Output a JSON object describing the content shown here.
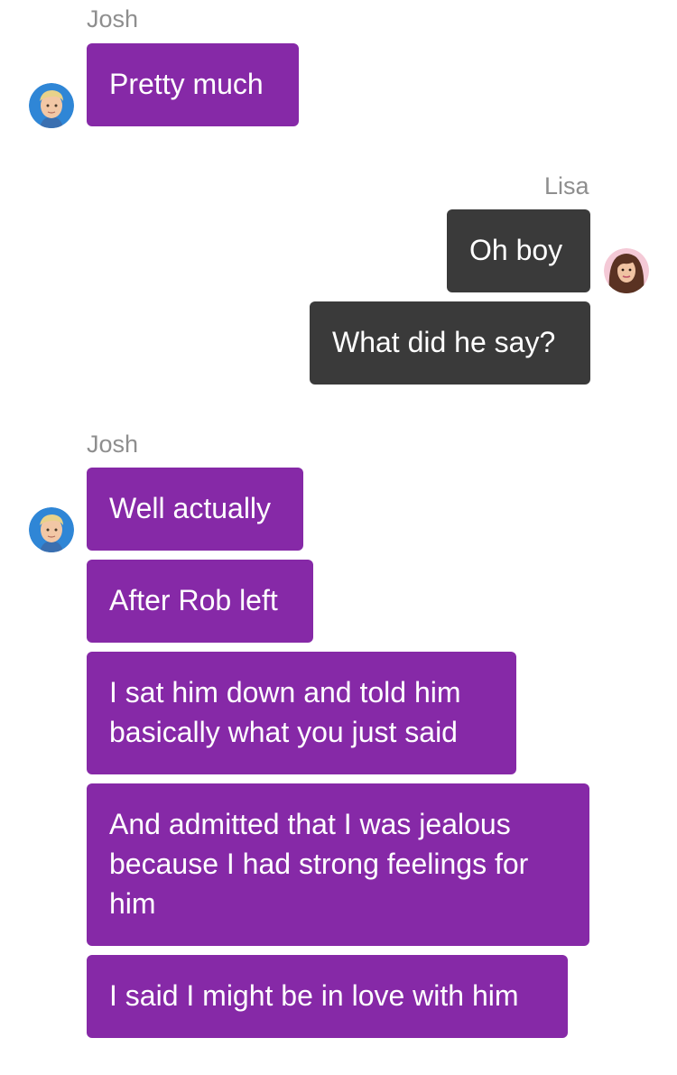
{
  "groups": [
    {
      "sender": "Josh",
      "messages": [
        "Pretty much"
      ]
    },
    {
      "sender": "Lisa",
      "messages": [
        "Oh boy",
        "What did he say?"
      ]
    },
    {
      "sender": "Josh",
      "messages": [
        "Well actually",
        "After Rob left",
        "I sat him down and told him\nbasically what you just said",
        "And admitted that I was jealous\nbecause I had strong feelings for\nhim",
        "I said I might be in love with him"
      ]
    }
  ],
  "avatars": {
    "josh": "josh-avatar",
    "lisa": "lisa-avatar"
  },
  "colors": {
    "josh_bubble": "#8629a7",
    "lisa_bubble": "#3a3a3a",
    "sender_name": "#8e8e8e"
  }
}
